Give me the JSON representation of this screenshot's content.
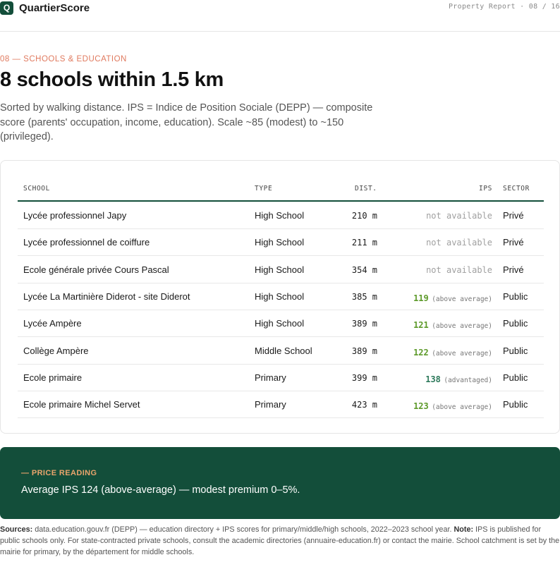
{
  "header": {
    "logo_letter": "Q",
    "brand": "QuartierScore",
    "report_meta": "Property Report · 08 / 16"
  },
  "section": {
    "kicker": "08 — SCHOOLS & EDUCATION",
    "title": "8 schools within 1.5 km",
    "subtitle": "Sorted by walking distance. IPS = Indice de Position Sociale (DEPP) — composite score (parents' occupation, income, education). Scale ~85 (modest) to ~150 (privileged)."
  },
  "table": {
    "columns": {
      "school": "SCHOOL",
      "type": "TYPE",
      "dist": "DIST.",
      "ips": "IPS",
      "sector": "SECTOR"
    },
    "rows": [
      {
        "school": "Lycée professionnel Japy",
        "type": "High School",
        "dist": "210 m",
        "ips": "not available",
        "ips_label": "",
        "sector": "Privé"
      },
      {
        "school": "Lycée professionnel de coiffure",
        "type": "High School",
        "dist": "211 m",
        "ips": "not available",
        "ips_label": "",
        "sector": "Privé"
      },
      {
        "school": "Ecole générale privée Cours Pascal",
        "type": "High School",
        "dist": "354 m",
        "ips": "not available",
        "ips_label": "",
        "sector": "Privé"
      },
      {
        "school": "Lycée La Martinière Diderot - site Diderot",
        "type": "High School",
        "dist": "385 m",
        "ips": "119",
        "ips_label": "(above average)",
        "sector": "Public"
      },
      {
        "school": "Lycée Ampère",
        "type": "High School",
        "dist": "389 m",
        "ips": "121",
        "ips_label": "(above average)",
        "sector": "Public"
      },
      {
        "school": "Collège Ampère",
        "type": "Middle School",
        "dist": "389 m",
        "ips": "122",
        "ips_label": "(above average)",
        "sector": "Public"
      },
      {
        "school": "Ecole primaire",
        "type": "Primary",
        "dist": "399 m",
        "ips": "138",
        "ips_label": "(advantaged)",
        "sector": "Public"
      },
      {
        "school": "Ecole primaire Michel Servet",
        "type": "Primary",
        "dist": "423 m",
        "ips": "123",
        "ips_label": "(above average)",
        "sector": "Public"
      }
    ]
  },
  "price_reading": {
    "kicker": "— PRICE READING",
    "text": "Average IPS 124 (above-average) — modest premium 0–5%."
  },
  "sources": {
    "label1": "Sources:",
    "text1": " data.education.gouv.fr (DEPP) — education directory + IPS scores for primary/middle/high schools, 2022–2023 school year. ",
    "label2": "Note:",
    "text2": " IPS is published for public schools only. For state-contracted private schools, consult the academic directories (annuaire-education.fr) or contact the mairie. School catchment is set by the mairie for primary, by the département for middle schools."
  },
  "colors": {
    "brand_green": "#134e3a",
    "accent_orange": "#e07a5f",
    "ips_above_average": "#5d9a2a",
    "ips_advantaged": "#2f7a5c"
  }
}
